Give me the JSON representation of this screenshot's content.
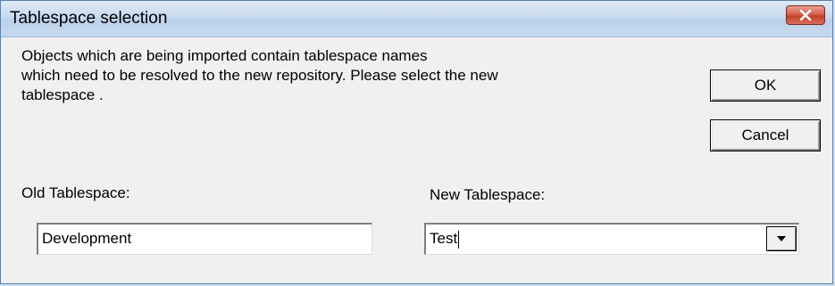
{
  "window": {
    "title": "Tablespace selection"
  },
  "message": "Objects which are being imported contain tablespace names\nwhich need to be resolved to the new repository. Please select the new\ntablespace .",
  "buttons": {
    "ok_label": "OK",
    "cancel_label": "Cancel"
  },
  "old_tablespace": {
    "label": "Old Tablespace:",
    "value": "Development"
  },
  "new_tablespace": {
    "label": "New Tablespace:",
    "value": "Test"
  },
  "icons": {
    "close": "close-icon",
    "dropdown": "chevron-down-icon"
  },
  "colors": {
    "close_button": "#c2402b",
    "titlebar": "#c8daee",
    "dialog_background": "#f0f0f0"
  }
}
